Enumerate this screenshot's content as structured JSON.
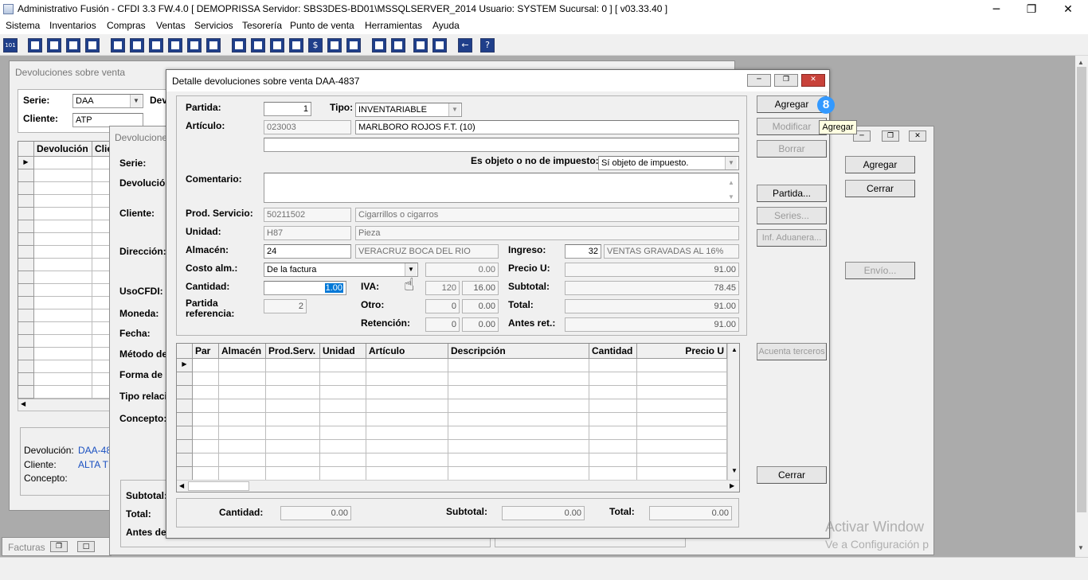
{
  "titlebar": {
    "title": "Administrativo Fusión - CFDI 3.3 FW.4.0 [ DEMOPRISSA   Servidor: SBS3DES-BD01\\MSSQLSERVER_2014   Usuario: SYSTEM      Sucursal: 0 ] [ v03.33.40 ]",
    "minimize": "─",
    "restore": "❐",
    "close": "✕"
  },
  "menu": [
    "Sistema",
    "Inventarios",
    "Compras",
    "Ventas",
    "Servicios",
    "Tesorería",
    "Punto de venta",
    "Herramientas",
    "Ayuda"
  ],
  "toolbar": {
    "icons": [
      "sistema-icon",
      "window-icon",
      "print-icon",
      "transfer-icon",
      "search-icon",
      "user-icon",
      "box-icon",
      "truck-icon",
      "printer-icon",
      "document-icon",
      "list-icon",
      "binoculars-icon",
      "inbox-icon",
      "export-icon",
      "add-icon",
      "dollar-icon",
      "report-icon",
      "ledger-icon",
      "home-icon",
      "zoom-icon",
      "refresh-icon",
      "undo-icon",
      "back-icon",
      "help-icon"
    ],
    "sistema_text": "101"
  },
  "win1": {
    "title": "Devoluciones sobre venta",
    "serie_label": "Serie:",
    "serie_value": "DAA",
    "dev_label": "Dev",
    "cliente_label": "Cliente:",
    "cliente_value": "ATP",
    "col1": "Devolución",
    "col2": "Clie",
    "foot_dev_label": "Devolución:",
    "foot_dev_value": "DAA-48",
    "foot_cli_label": "Cliente:",
    "foot_cli_value": "ALTA TE",
    "foot_con_label": "Concepto:",
    "tab_label": "Facturas"
  },
  "win2": {
    "title": "Devolucione",
    "labels": {
      "serie": "Serie:",
      "devolucion": "Devolución",
      "cliente": "Cliente:",
      "direccion": "Dirección:",
      "usocfdi": "UsoCFDI:",
      "moneda": "Moneda:",
      "fecha": "Fecha:",
      "metodo": "Método de",
      "forma": "Forma de p",
      "tipo": "Tipo relacio",
      "concepto": "Concepto:",
      "subtotal": "Subtotal:",
      "total": "Total:",
      "antes": "Antes de"
    },
    "agregar": "Agregar",
    "cerrar": "Cerrar",
    "envio": "Envío..."
  },
  "detail": {
    "title": "Detalle devoluciones sobre venta DAA-4837",
    "partida_label": "Partida:",
    "partida_value": "1",
    "tipo_label": "Tipo:",
    "tipo_value": "INVENTARIABLE",
    "articulo_label": "Artículo:",
    "articulo_code": "023003",
    "articulo_desc": "MARLBORO ROJOS F.T. (10)",
    "objeto_label": "Es objeto o no de impuesto:",
    "objeto_value": "Sí objeto de impuesto.",
    "comentario_label": "Comentario:",
    "prodserv_label": "Prod. Servicio:",
    "prodserv_code": "50211502",
    "prodserv_desc": "Cigarrillos o cigarros",
    "unidad_label": "Unidad:",
    "unidad_code": "H87",
    "unidad_desc": "Pieza",
    "almacen_label": "Almacén:",
    "almacen_code": "24",
    "almacen_desc": "VERACRUZ BOCA DEL RIO",
    "ingreso_label": "Ingreso:",
    "ingreso_code": "32",
    "ingreso_desc": "VENTAS GRAVADAS AL 16%",
    "costo_label": "Costo alm.:",
    "costo_value": "De la factura",
    "costo_amount": "0.00",
    "preciou_label": "Precio U:",
    "preciou_value": "91.00",
    "cantidad_label": "Cantidad:",
    "cantidad_value": "1.00",
    "iva_label": "IVA:",
    "iva_rate": "120",
    "iva_amount": "16.00",
    "subtotal_label": "Subtotal:",
    "subtotal_value": "78.45",
    "partidaref_label1": "Partida",
    "partidaref_label2": "referencia:",
    "partidaref_value": "2",
    "otro_label": "Otro:",
    "otro_rate": "0",
    "otro_amount": "0.00",
    "total_label": "Total:",
    "total_value": "91.00",
    "retencion_label": "Retención:",
    "retencion_rate": "0",
    "retencion_amount": "0.00",
    "antesret_label": "Antes ret.:",
    "antesret_value": "91.00",
    "grid_headers": [
      "Par",
      "Almacén",
      "Prod.Serv.",
      "Unidad",
      "Artículo",
      "Descripción",
      "Cantidad",
      "Precio U"
    ],
    "foot_cantidad_label": "Cantidad:",
    "foot_cantidad_value": "0.00",
    "foot_subtotal_label": "Subtotal:",
    "foot_subtotal_value": "0.00",
    "foot_total_label": "Total:",
    "foot_total_value": "0.00",
    "buttons": {
      "agregar": "Agregar",
      "modificar": "Modificar",
      "borrar": "Borrar",
      "partida": "Partida...",
      "series": "Series...",
      "aduanera": "Inf. Aduanera...",
      "terceros": "Acuenta terceros",
      "cerrar": "Cerrar"
    },
    "badge": "8",
    "tooltip": "Agregar"
  },
  "watermark": {
    "line1": "Activar Window",
    "line2": "Ve a Configuración p"
  },
  "colors": {
    "accent": "#3399ff",
    "selection": "#0078d7",
    "titlebar_active": "#ffffff"
  }
}
